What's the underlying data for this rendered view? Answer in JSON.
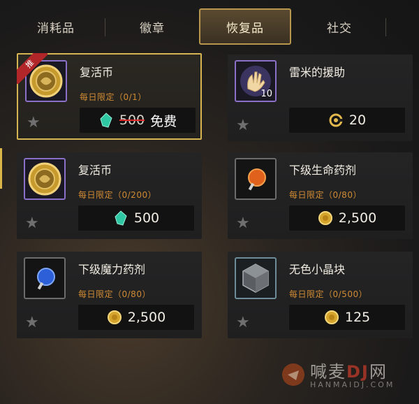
{
  "tabs": [
    "消耗品",
    "徽章",
    "恢复品",
    "社交"
  ],
  "active_tab": 2,
  "items": [
    {
      "name": "复活币",
      "limit": "每日限定（0/1）",
      "price_old": "500",
      "price_free": "免费",
      "currency": "gem-icon",
      "ribbon": "推",
      "icon": "revive-coin-icon",
      "selected": true
    },
    {
      "name": "雷米的援助",
      "limit": "",
      "price": "20",
      "currency": "c-token-icon",
      "icon": "helping-hand-icon",
      "icon_count": "10"
    },
    {
      "name": "复活币",
      "limit": "每日限定（0/200）",
      "price": "500",
      "currency": "gem-icon",
      "icon": "revive-coin-icon"
    },
    {
      "name": "下级生命药剂",
      "limit": "每日限定（0/80）",
      "price": "2,500",
      "currency": "gold-coin-icon",
      "icon": "hp-potion-icon"
    },
    {
      "name": "下级魔力药剂",
      "limit": "每日限定（0/80）",
      "price": "2,500",
      "currency": "gold-coin-icon",
      "icon": "mp-potion-icon"
    },
    {
      "name": "无色小晶块",
      "limit": "每日限定（0/500）",
      "price": "125",
      "currency": "gold-coin-icon",
      "icon": "crystal-icon"
    }
  ],
  "watermark": {
    "text": "喊麦",
    "sub": "HANMAIDJ.COM",
    "tail": "网"
  },
  "colors": {
    "gold_border": "#d6b451",
    "limit_orange": "#d08b33",
    "strike_red": "#e0282a"
  }
}
